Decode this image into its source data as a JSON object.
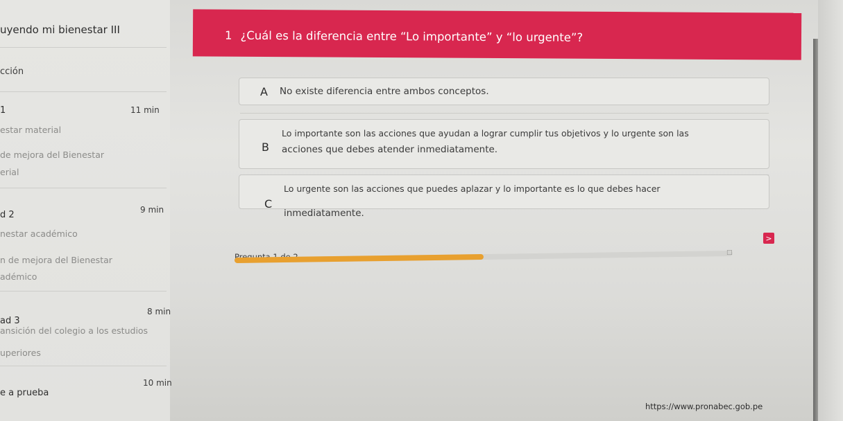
{
  "sidebar": {
    "title": "uyendo mi bienestar III",
    "section": "cción",
    "units": [
      {
        "label": "1",
        "time": "11 min",
        "items": [
          "estar material",
          "de mejora del Bienestar",
          "erial"
        ]
      },
      {
        "label": "d 2",
        "time": "9 min",
        "items": [
          "nestar académico",
          "n de mejora del Bienestar",
          "adémico"
        ]
      },
      {
        "label": "ad 3",
        "time": "8 min",
        "items": [
          "ansición del colegio a los estudios",
          "uperiores"
        ]
      },
      {
        "label": "e a prueba",
        "time": "10 min",
        "items": []
      }
    ]
  },
  "question": {
    "number": "1",
    "text": "¿Cuál es la diferencia entre “Lo importante” y “lo urgente”?",
    "options": [
      {
        "letter": "A",
        "lines": [
          "No existe diferencia entre ambos conceptos."
        ]
      },
      {
        "letter": "B",
        "lines": [
          "Lo importante son las acciones que ayudan a lograr cumplir tus objetivos y lo urgente son las",
          "acciones que debes atender inmediatamente."
        ]
      },
      {
        "letter": "C",
        "lines": [
          "Lo urgente son las acciones que puedes aplazar y lo importante es lo que debes hacer",
          "inmediatamente."
        ]
      }
    ]
  },
  "progress": {
    "label": "Pregunta 1 de 2",
    "fraction": 0.5
  },
  "next_icon": ">",
  "url": "https://www.pronabec.gob.pe",
  "colors": {
    "header": "#d8274f",
    "progress": "#e8a02f"
  }
}
